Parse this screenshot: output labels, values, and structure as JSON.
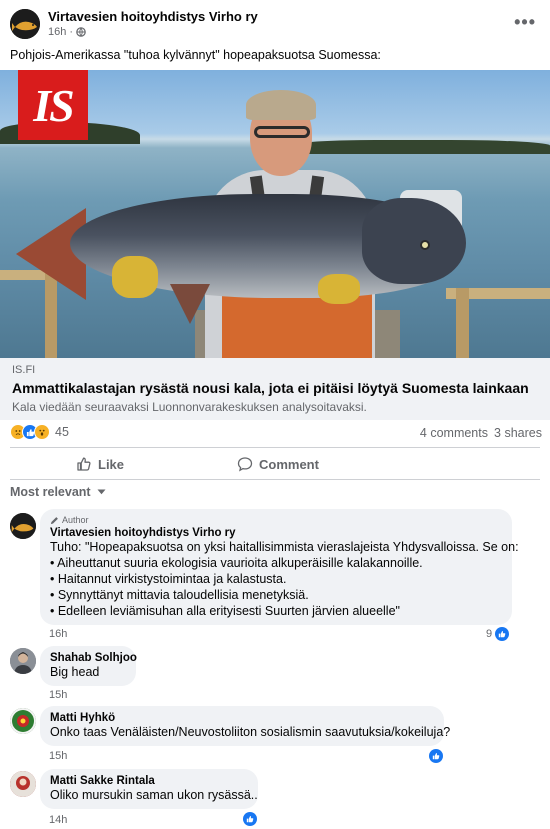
{
  "post": {
    "page_name": "Virtavesien hoitoyhdistys Virho ry",
    "time": "16h",
    "audience_icon": "globe-icon",
    "text": "Pohjois-Amerikassa \"tuhoa kylvännyt\" hopeapaksuotsa Suomessa:"
  },
  "link": {
    "logo_text": "IS",
    "domain": "IS.FI",
    "title": "Ammattikalastajan rysästä nousi kala, jota ei pitäisi löytyä Suomesta lainkaan",
    "description": "Kala viedään seuraavaksi Luonnonvarakeskuksen analysoitavaksi."
  },
  "stats": {
    "reaction_icons": [
      "sad-icon",
      "like-icon",
      "wow-icon"
    ],
    "reaction_count": "45",
    "comments": "4 comments",
    "shares": "3 shares"
  },
  "actions": {
    "like": "Like",
    "comment": "Comment"
  },
  "sort": {
    "label": "Most relevant"
  },
  "comments": [
    {
      "badge": "Author",
      "author": "Virtavesien hoitoyhdistys Virho ry",
      "lines": [
        "Tuho: \"Hopeapaksuotsa on yksi haitallisimmista vieraslajeista Yhdysvalloissa. Se on:",
        "• Aiheuttanut suuria ekologisia vaurioita alkuperäisille kalakannoille.",
        "• Haitannut virkistystoimintaa ja kalastusta.",
        "• Synnyttänyt mittavia taloudellisia menetyksiä.",
        "• Edelleen leviämisuhan alla erityisesti Suurten järvien alueelle\""
      ],
      "time": "16h",
      "likes": "9"
    },
    {
      "author": "Shahab Solhjoo",
      "lines": [
        "Big head"
      ],
      "time": "15h"
    },
    {
      "author": "Matti Hyhkö",
      "lines": [
        "Onko taas Venäläisten/Neuvostoliiton sosialismin saavutuksia/kokeiluja?"
      ],
      "time": "15h",
      "likes": ""
    },
    {
      "author": "Matti Sakke Rintala",
      "lines": [
        "Oliko mursukin saman ukon rysässä.."
      ],
      "time": "14h",
      "likes": ""
    }
  ],
  "colors": {
    "accent": "#1877f2",
    "secondary_text": "#65676b",
    "bubble": "#f0f2f5",
    "logo_red": "#d91c1c"
  }
}
